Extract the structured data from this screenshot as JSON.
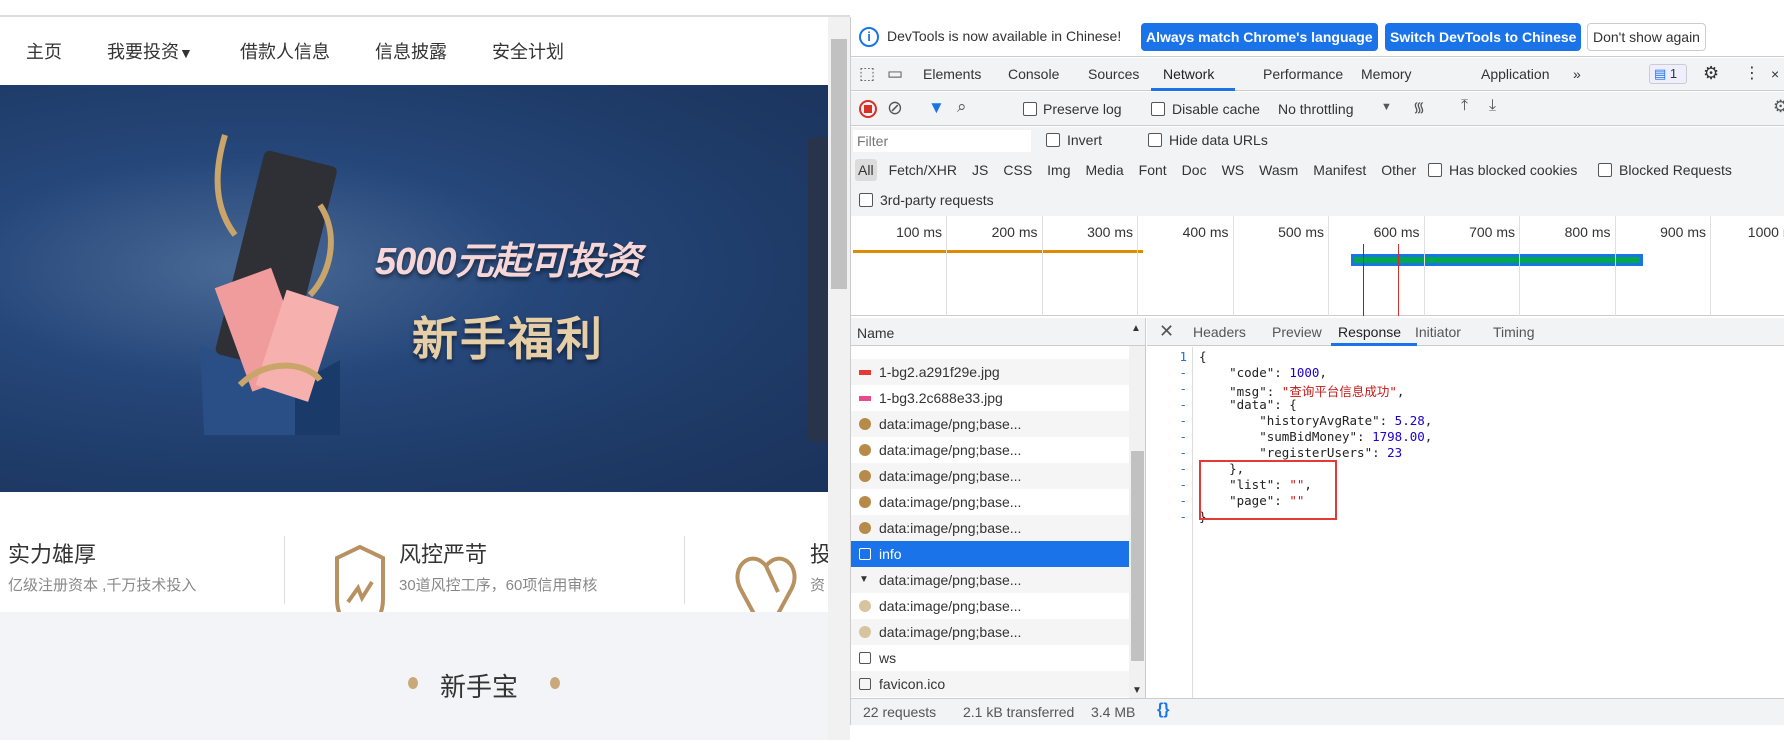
{
  "page": {
    "nav": [
      "主页",
      "我要投资",
      "借款人信息",
      "信息披露",
      "安全计划"
    ],
    "banner": {
      "line1": "5000元起可投资",
      "line2": "新手福利"
    },
    "features": [
      {
        "title": "实力雄厚",
        "subtitle": "亿级注册资本 ,千万技术投入",
        "icon": "none"
      },
      {
        "title": "风控严苛",
        "subtitle": "30道风控工序，60项信用审核",
        "icon": "shield-icon"
      },
      {
        "title": "投",
        "subtitle": "资",
        "icon": "heart-icon"
      }
    ],
    "section_title": "新手宝",
    "accent": "#c9a979"
  },
  "devtools": {
    "infobar": {
      "message": "DevTools is now available in Chinese!",
      "btn_match": "Always match Chrome's language",
      "btn_switch": "Switch DevTools to Chinese",
      "btn_dismiss": "Don't show again"
    },
    "tabs": [
      "Elements",
      "Console",
      "Sources",
      "Network",
      "Performance",
      "Memory",
      "Application"
    ],
    "active_tab": "Network",
    "issues_count": "1",
    "toolbar": {
      "preserve_log": "Preserve log",
      "disable_cache": "Disable cache",
      "throttling": "No throttling"
    },
    "filter": {
      "placeholder": "Filter",
      "invert": "Invert",
      "hide_data_urls": "Hide data URLs",
      "types": [
        "All",
        "Fetch/XHR",
        "JS",
        "CSS",
        "Img",
        "Media",
        "Font",
        "Doc",
        "WS",
        "Wasm",
        "Manifest",
        "Other"
      ],
      "has_blocked_cookies": "Has blocked cookies",
      "blocked_requests": "Blocked Requests",
      "third_party": "3rd-party requests"
    },
    "timeline_ticks": [
      "100 ms",
      "200 ms",
      "300 ms",
      "400 ms",
      "500 ms",
      "600 ms",
      "700 ms",
      "800 ms",
      "900 ms",
      "1000 ms"
    ],
    "name_header": "Name",
    "requests": [
      {
        "name": "1-bg2.a291f29e.jpg",
        "icon": "image-red"
      },
      {
        "name": "1-bg3.2c688e33.jpg",
        "icon": "image-pink"
      },
      {
        "name": "data:image/png;base...",
        "icon": "image-gold"
      },
      {
        "name": "data:image/png;base...",
        "icon": "image-gold"
      },
      {
        "name": "data:image/png;base...",
        "icon": "image-gold"
      },
      {
        "name": "data:image/png;base...",
        "icon": "image-gold"
      },
      {
        "name": "data:image/png;base...",
        "icon": "image-gold"
      },
      {
        "name": "info",
        "icon": "document",
        "selected": true
      },
      {
        "name": "data:image/png;base...",
        "icon": "triangle"
      },
      {
        "name": "data:image/png;base...",
        "icon": "image-light"
      },
      {
        "name": "data:image/png;base...",
        "icon": "image-light"
      },
      {
        "name": "ws",
        "icon": "document"
      },
      {
        "name": "favicon.ico",
        "icon": "document"
      }
    ],
    "detail_tabs": [
      "Headers",
      "Preview",
      "Response",
      "Initiator",
      "Timing"
    ],
    "active_detail_tab": "Response",
    "response": {
      "code": "1000",
      "msg": "查询平台信息成功",
      "historyAvgRate": "5.28",
      "sumBidMoney": "1798.00",
      "registerUsers": "23",
      "list": "",
      "page": ""
    },
    "status": {
      "requests": "22 requests",
      "transferred": "2.1 kB transferred",
      "resources": "3.4 MB"
    }
  }
}
